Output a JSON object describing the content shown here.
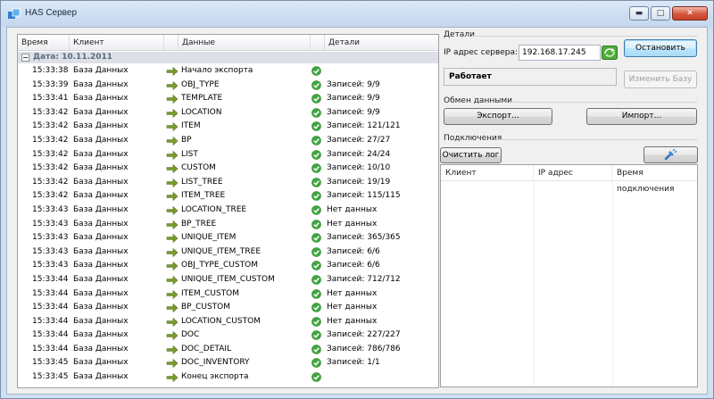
{
  "window": {
    "title": "HAS Сервер",
    "controls": {
      "minimize": "▬",
      "maximize": "□",
      "close": "✕"
    }
  },
  "log": {
    "columns": {
      "time": "Время",
      "client": "Клиент",
      "data": "Данные",
      "details": "Детали"
    },
    "group": {
      "toggle": "−",
      "label": "Дата: 10.11.2011"
    },
    "rows": [
      {
        "time": "15:33:38",
        "client": "База Данных",
        "data": "Начало экспорта",
        "details": ""
      },
      {
        "time": "15:33:39",
        "client": "База Данных",
        "data": "OBJ_TYPE",
        "details": "Записей: 9/9"
      },
      {
        "time": "15:33:41",
        "client": "База Данных",
        "data": "TEMPLATE",
        "details": "Записей: 9/9"
      },
      {
        "time": "15:33:42",
        "client": "База Данных",
        "data": "LOCATION",
        "details": "Записей: 9/9"
      },
      {
        "time": "15:33:42",
        "client": "База Данных",
        "data": "ITEM",
        "details": "Записей: 121/121"
      },
      {
        "time": "15:33:42",
        "client": "База Данных",
        "data": "BP",
        "details": "Записей: 27/27"
      },
      {
        "time": "15:33:42",
        "client": "База Данных",
        "data": "LIST",
        "details": "Записей: 24/24"
      },
      {
        "time": "15:33:42",
        "client": "База Данных",
        "data": "CUSTOM",
        "details": "Записей: 10/10"
      },
      {
        "time": "15:33:42",
        "client": "База Данных",
        "data": "LIST_TREE",
        "details": "Записей: 19/19"
      },
      {
        "time": "15:33:42",
        "client": "База Данных",
        "data": "ITEM_TREE",
        "details": "Записей: 115/115"
      },
      {
        "time": "15:33:43",
        "client": "База Данных",
        "data": "LOCATION_TREE",
        "details": "Нет данных"
      },
      {
        "time": "15:33:43",
        "client": "База Данных",
        "data": "BP_TREE",
        "details": "Нет данных"
      },
      {
        "time": "15:33:43",
        "client": "База Данных",
        "data": "UNIQUE_ITEM",
        "details": "Записей: 365/365"
      },
      {
        "time": "15:33:43",
        "client": "База Данных",
        "data": "UNIQUE_ITEM_TREE",
        "details": "Записей: 6/6"
      },
      {
        "time": "15:33:43",
        "client": "База Данных",
        "data": "OBJ_TYPE_CUSTOM",
        "details": "Записей: 6/6"
      },
      {
        "time": "15:33:44",
        "client": "База Данных",
        "data": "UNIQUE_ITEM_CUSTOM",
        "details": "Записей: 712/712"
      },
      {
        "time": "15:33:44",
        "client": "База Данных",
        "data": "ITEM_CUSTOM",
        "details": "Нет данных"
      },
      {
        "time": "15:33:44",
        "client": "База Данных",
        "data": "BP_CUSTOM",
        "details": "Нет данных"
      },
      {
        "time": "15:33:44",
        "client": "База Данных",
        "data": "LOCATION_CUSTOM",
        "details": "Нет данных"
      },
      {
        "time": "15:33:44",
        "client": "База Данных",
        "data": "DOC",
        "details": "Записей: 227/227"
      },
      {
        "time": "15:33:44",
        "client": "База Данных",
        "data": "DOC_DETAIL",
        "details": "Записей: 786/786"
      },
      {
        "time": "15:33:45",
        "client": "База Данных",
        "data": "DOC_INVENTORY",
        "details": "Записей: 1/1"
      },
      {
        "time": "15:33:45",
        "client": "База Данных",
        "data": "Конец экспорта",
        "details": ""
      }
    ]
  },
  "details": {
    "title": "Детали",
    "ip_label": "IP адрес сервера:",
    "ip_value": "192.168.17.245",
    "status": "Работает",
    "stop_button": "Остановить",
    "change_db_button": "Изменить Базу"
  },
  "exchange": {
    "title": "Обмен данными",
    "export_button": "Экспорт...",
    "import_button": "Импорт..."
  },
  "connections": {
    "title": "Подключения",
    "clear_log_button": "Очистить лог",
    "columns": {
      "client": "Клиент",
      "ip": "IP адрес",
      "time": "Время подключения"
    }
  },
  "colors": {
    "arrow": "#7a9a2c",
    "ok": "#3ea83e",
    "accent": "#3c7fb1"
  }
}
